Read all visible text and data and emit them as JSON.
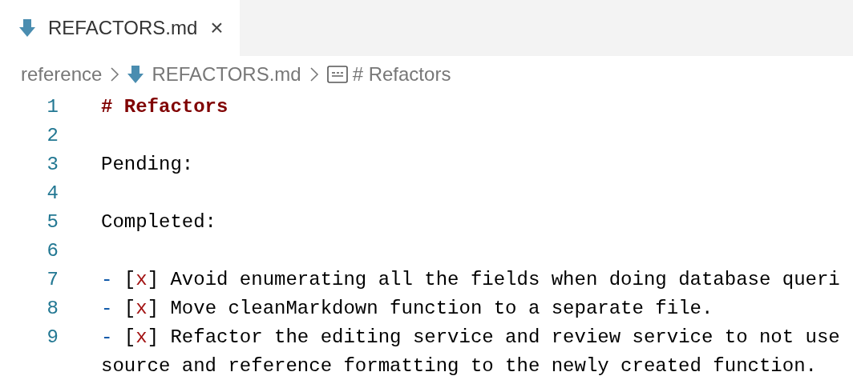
{
  "tabs": [
    {
      "label": "REFACTORS.md",
      "selected": true,
      "close": "×"
    }
  ],
  "breadcrumb": [
    {
      "kind": "folder",
      "label": "reference"
    },
    {
      "kind": "file",
      "label": "REFACTORS.md"
    },
    {
      "kind": "symbol",
      "label": "# Refactors"
    }
  ],
  "lines": [
    {
      "number": "1",
      "tokens": [
        {
          "kind": "heading",
          "text": "# Refactors"
        }
      ]
    },
    {
      "number": "2"
    },
    {
      "number": "3",
      "tokens": [
        {
          "kind": "text",
          "text": "Pending:"
        }
      ]
    },
    {
      "number": "4"
    },
    {
      "number": "5",
      "tokens": [
        {
          "kind": "text",
          "text": "Completed:"
        }
      ]
    },
    {
      "number": "6"
    },
    {
      "number": "7",
      "tokens": [
        {
          "kind": "bullet",
          "text": "-"
        },
        {
          "kind": "text",
          "text": " ["
        },
        {
          "kind": "mark",
          "text": "x"
        },
        {
          "kind": "text",
          "text": "] Avoid enumerating all the fields when doing database queri"
        }
      ]
    },
    {
      "number": "8",
      "tokens": [
        {
          "kind": "bullet",
          "text": "-"
        },
        {
          "kind": "text",
          "text": " ["
        },
        {
          "kind": "mark",
          "text": "x"
        },
        {
          "kind": "text",
          "text": "] Move cleanMarkdown function to a separate file."
        }
      ]
    },
    {
      "number": "9",
      "tokens": [
        {
          "kind": "bullet",
          "text": "-"
        },
        {
          "kind": "text",
          "text": " ["
        },
        {
          "kind": "mark",
          "text": "x"
        },
        {
          "kind": "text",
          "text": "] Refactor the editing service and review service to not use"
        }
      ],
      "wrap": "source and reference formatting to the newly created function."
    }
  ]
}
